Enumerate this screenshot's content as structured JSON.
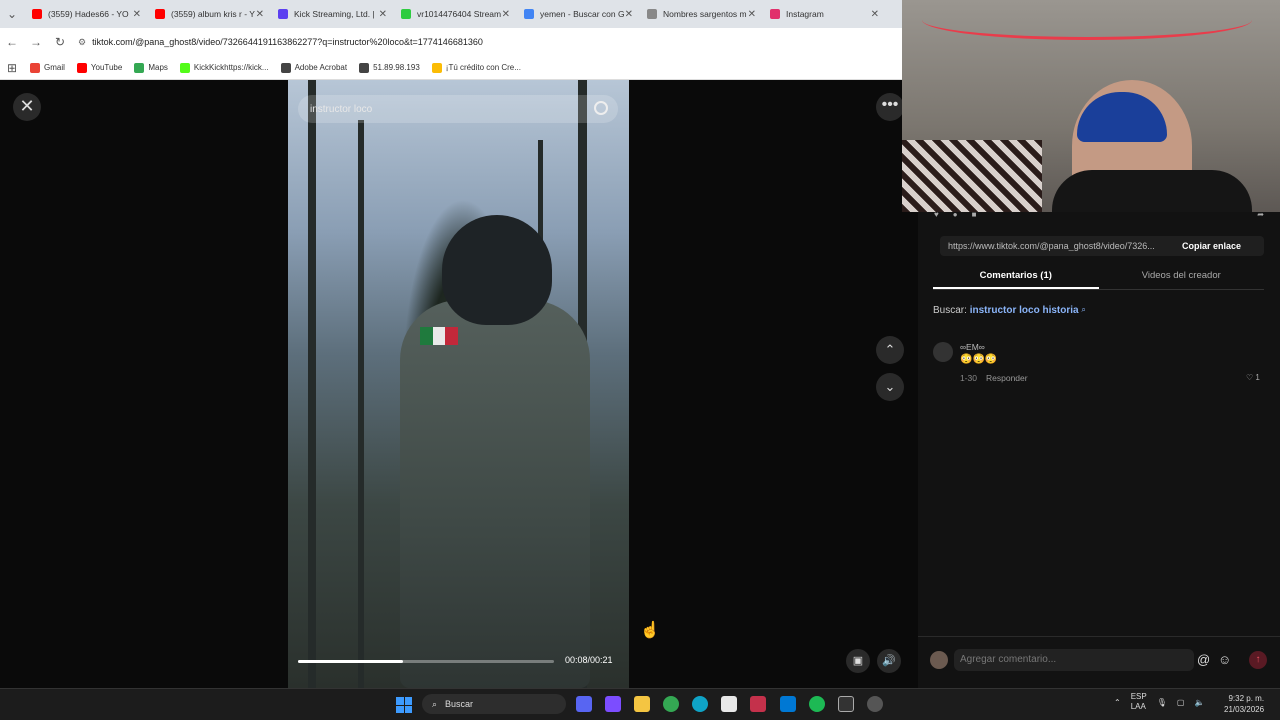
{
  "browser": {
    "tabs": [
      {
        "label": "(3559) Hades66 - YO",
        "color": "#ff0000"
      },
      {
        "label": "(3559) album kris r - Y",
        "color": "#ff0000"
      },
      {
        "label": "Kick Streaming, Ltd. |",
        "color": "#5b3ff0"
      },
      {
        "label": "vr1014476404 Stream",
        "color": "#2ecc40"
      },
      {
        "label": "yemen - Buscar con G",
        "color": "#4285f4"
      },
      {
        "label": "Nombres sargentos m",
        "color": "#888888"
      },
      {
        "label": "Instagram",
        "color": "#e1306c"
      }
    ],
    "url": "tiktok.com/@pana_ghost8/video/7326644191163862277?q=instructor%20loco&t=1774146681360",
    "bookmarks": [
      {
        "label": "Gmail",
        "color": "#ea4335"
      },
      {
        "label": "YouTube",
        "color": "#ff0000"
      },
      {
        "label": "Maps",
        "color": "#34a853"
      },
      {
        "label": "KickKickhttps://kick...",
        "color": "#53fc18"
      },
      {
        "label": "Adobe Acrobat",
        "color": "#444444"
      },
      {
        "label": "51.89.98.193",
        "color": "#444444"
      },
      {
        "label": "¡Tú crédito con Cre...",
        "color": "#fbbc05"
      }
    ]
  },
  "video": {
    "search_query": "instructor loco",
    "time": "00:08/00:21",
    "progress": 0.41
  },
  "panel": {
    "share_link": "https://www.tiktok.com/@pana_ghost8/video/7326...",
    "copy_label": "Copiar enlace",
    "tabs": [
      "Comentarios (1)",
      "Videos del creador"
    ],
    "search_prefix": "Buscar:",
    "search_term": "instructor loco historia",
    "comment": {
      "user": "∞EM∞",
      "text": "😳😳😳",
      "date": "1-30",
      "reply": "Responder",
      "likes": "1"
    },
    "input_placeholder": "Agregar comentario..."
  },
  "taskbar": {
    "search_label": "Buscar",
    "lang": "ESP\nLAA",
    "time": "9:32 p. m.",
    "date": "21/03/2026"
  }
}
